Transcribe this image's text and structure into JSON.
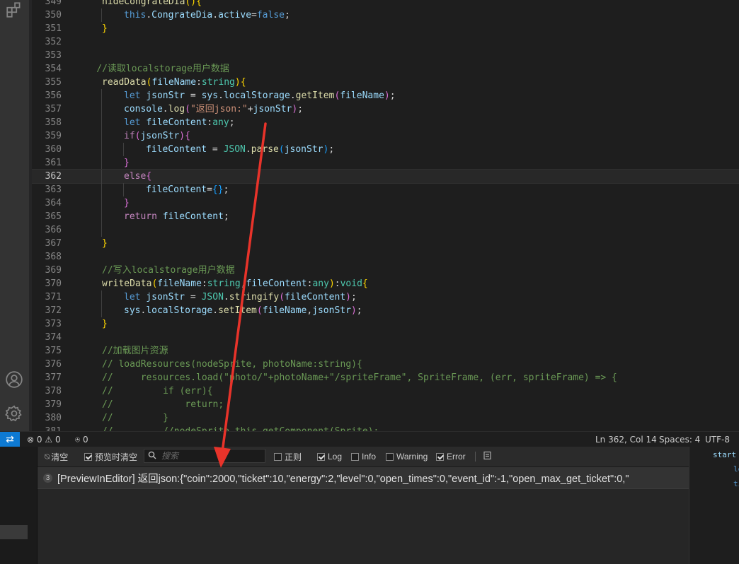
{
  "editor": {
    "lines": [
      {
        "n": "349",
        "tokens": [
          [
            "fn",
            "hideCongrateDia"
          ],
          [
            "br1",
            "()"
          ],
          [
            "br1",
            "{"
          ]
        ]
      },
      {
        "n": "350",
        "tokens": [
          [
            "kw",
            "this"
          ],
          [
            "plain",
            "."
          ],
          [
            "var",
            "CongrateDia"
          ],
          [
            "plain",
            "."
          ],
          [
            "var",
            "active"
          ],
          [
            "plain",
            "="
          ],
          [
            "kw",
            "false"
          ],
          [
            "plain",
            ";"
          ]
        ]
      },
      {
        "n": "351",
        "tokens": [
          [
            "br1",
            "}"
          ]
        ]
      },
      {
        "n": "352",
        "tokens": []
      },
      {
        "n": "353",
        "tokens": []
      },
      {
        "n": "354",
        "tokens": [
          [
            "cm",
            "//读取localstorage用户数据"
          ]
        ]
      },
      {
        "n": "355",
        "tokens": [
          [
            "fn",
            "readData"
          ],
          [
            "br1",
            "("
          ],
          [
            "var",
            "fileName"
          ],
          [
            "plain",
            ":"
          ],
          [
            "type",
            "string"
          ],
          [
            "br1",
            ")"
          ],
          [
            "br1",
            "{"
          ]
        ]
      },
      {
        "n": "356",
        "tokens": [
          [
            "kw",
            "let "
          ],
          [
            "var",
            "jsonStr"
          ],
          [
            "plain",
            " = "
          ],
          [
            "var",
            "sys"
          ],
          [
            "plain",
            "."
          ],
          [
            "var",
            "localStorage"
          ],
          [
            "plain",
            "."
          ],
          [
            "fn",
            "getItem"
          ],
          [
            "br2",
            "("
          ],
          [
            "var",
            "fileName"
          ],
          [
            "br2",
            ")"
          ],
          [
            "plain",
            ";"
          ]
        ]
      },
      {
        "n": "357",
        "tokens": [
          [
            "var",
            "console"
          ],
          [
            "plain",
            "."
          ],
          [
            "fn",
            "log"
          ],
          [
            "br2",
            "("
          ],
          [
            "str",
            "\"返回json:\""
          ],
          [
            "plain",
            "+"
          ],
          [
            "var",
            "jsonStr"
          ],
          [
            "br2",
            ")"
          ],
          [
            "plain",
            ";"
          ]
        ]
      },
      {
        "n": "358",
        "tokens": [
          [
            "kw",
            "let "
          ],
          [
            "var",
            "fileContent"
          ],
          [
            "plain",
            ":"
          ],
          [
            "type",
            "any"
          ],
          [
            "plain",
            ";"
          ]
        ]
      },
      {
        "n": "359",
        "tokens": [
          [
            "ctl",
            "if"
          ],
          [
            "br2",
            "("
          ],
          [
            "var",
            "jsonStr"
          ],
          [
            "br2",
            ")"
          ],
          [
            "br2",
            "{"
          ]
        ]
      },
      {
        "n": "360",
        "tokens": [
          [
            "var",
            "fileContent"
          ],
          [
            "plain",
            " = "
          ],
          [
            "type",
            "JSON"
          ],
          [
            "plain",
            "."
          ],
          [
            "fn",
            "parse"
          ],
          [
            "br3",
            "("
          ],
          [
            "var",
            "jsonStr"
          ],
          [
            "br3",
            ")"
          ],
          [
            "plain",
            ";"
          ]
        ]
      },
      {
        "n": "361",
        "tokens": [
          [
            "br2",
            "}"
          ]
        ]
      },
      {
        "n": "362",
        "tokens": [
          [
            "ctl",
            "else"
          ],
          [
            "br2",
            "{"
          ]
        ]
      },
      {
        "n": "363",
        "tokens": [
          [
            "var",
            "fileContent"
          ],
          [
            "plain",
            "="
          ],
          [
            "br3",
            "{}"
          ],
          [
            "plain",
            ";"
          ]
        ]
      },
      {
        "n": "364",
        "tokens": [
          [
            "br2",
            "}"
          ]
        ]
      },
      {
        "n": "365",
        "tokens": [
          [
            "ctl",
            "return "
          ],
          [
            "var",
            "fileContent"
          ],
          [
            "plain",
            ";"
          ]
        ]
      },
      {
        "n": "366",
        "tokens": []
      },
      {
        "n": "367",
        "tokens": [
          [
            "br1",
            "}"
          ]
        ]
      },
      {
        "n": "368",
        "tokens": []
      },
      {
        "n": "369",
        "tokens": [
          [
            "cm",
            "//写入localstorage用户数据"
          ]
        ]
      },
      {
        "n": "370",
        "tokens": [
          [
            "fn",
            "writeData"
          ],
          [
            "br1",
            "("
          ],
          [
            "var",
            "fileName"
          ],
          [
            "plain",
            ":"
          ],
          [
            "type",
            "string"
          ],
          [
            "plain",
            ","
          ],
          [
            "var",
            "fileContent"
          ],
          [
            "plain",
            ":"
          ],
          [
            "type",
            "any"
          ],
          [
            "br1",
            ")"
          ],
          [
            "plain",
            ":"
          ],
          [
            "type",
            "void"
          ],
          [
            "br1",
            "{"
          ]
        ]
      },
      {
        "n": "371",
        "tokens": [
          [
            "kw",
            "let "
          ],
          [
            "var",
            "jsonStr"
          ],
          [
            "plain",
            " = "
          ],
          [
            "type",
            "JSON"
          ],
          [
            "plain",
            "."
          ],
          [
            "fn",
            "stringify"
          ],
          [
            "br2",
            "("
          ],
          [
            "var",
            "fileContent"
          ],
          [
            "br2",
            ")"
          ],
          [
            "plain",
            ";"
          ]
        ]
      },
      {
        "n": "372",
        "tokens": [
          [
            "var",
            "sys"
          ],
          [
            "plain",
            "."
          ],
          [
            "var",
            "localStorage"
          ],
          [
            "plain",
            "."
          ],
          [
            "fn",
            "setItem"
          ],
          [
            "br2",
            "("
          ],
          [
            "var",
            "fileName"
          ],
          [
            "plain",
            ","
          ],
          [
            "var",
            "jsonStr"
          ],
          [
            "br2",
            ")"
          ],
          [
            "plain",
            ";"
          ]
        ]
      },
      {
        "n": "373",
        "tokens": [
          [
            "br1",
            "}"
          ]
        ]
      },
      {
        "n": "374",
        "tokens": []
      },
      {
        "n": "375",
        "tokens": [
          [
            "cm",
            "//加载图片资源"
          ]
        ]
      },
      {
        "n": "376",
        "tokens": [
          [
            "cm",
            "// loadResources(nodeSprite, photoName:string){"
          ]
        ]
      },
      {
        "n": "377",
        "tokens": [
          [
            "cm",
            "//     resources.load(\"photo/\"+photoName+\"/spriteFrame\", SpriteFrame, (err, spriteFrame) => {"
          ]
        ]
      },
      {
        "n": "378",
        "tokens": [
          [
            "cm",
            "//         if (err){"
          ]
        ]
      },
      {
        "n": "379",
        "tokens": [
          [
            "cm",
            "//             return;"
          ]
        ]
      },
      {
        "n": "380",
        "tokens": [
          [
            "cm",
            "//         }"
          ]
        ]
      },
      {
        "n": "381",
        "tokens": [
          [
            "cm",
            "//         //nodeSprite.this.getComponent(Sprite);"
          ]
        ]
      }
    ]
  },
  "statusbar": {
    "errors": "0",
    "warnings": "0",
    "ports": "0",
    "position": "Ln 362, Col 14",
    "spaces": "Spaces: 4",
    "encoding": "UTF-8"
  },
  "console": {
    "clear_label": "清空",
    "preview_clear_label": "预览时清空",
    "search_placeholder": "搜索",
    "filters": {
      "regex": "正则",
      "log": "Log",
      "info": "Info",
      "warning": "Warning",
      "error": "Error"
    },
    "entry": {
      "count": "3",
      "text": "[PreviewInEditor] 返回json:{\"coin\":2000,\"ticket\":10,\"energy\":2,\"level\":0,\"open_times\":0,\"event_id\":-1,\"open_max_get_ticket\":0,\""
    }
  },
  "side_code": [
    "start",
    "le",
    "ti"
  ],
  "colors": {
    "annotation_arrow": "#e8332a",
    "remote_button": "#0e7ad3"
  },
  "icons": [
    "extensions-icon",
    "account-icon",
    "settings-gear-icon",
    "remote-icon",
    "error-icon",
    "warning-icon",
    "broadcast-icon",
    "clear-icon",
    "search-icon",
    "log-file-icon"
  ]
}
